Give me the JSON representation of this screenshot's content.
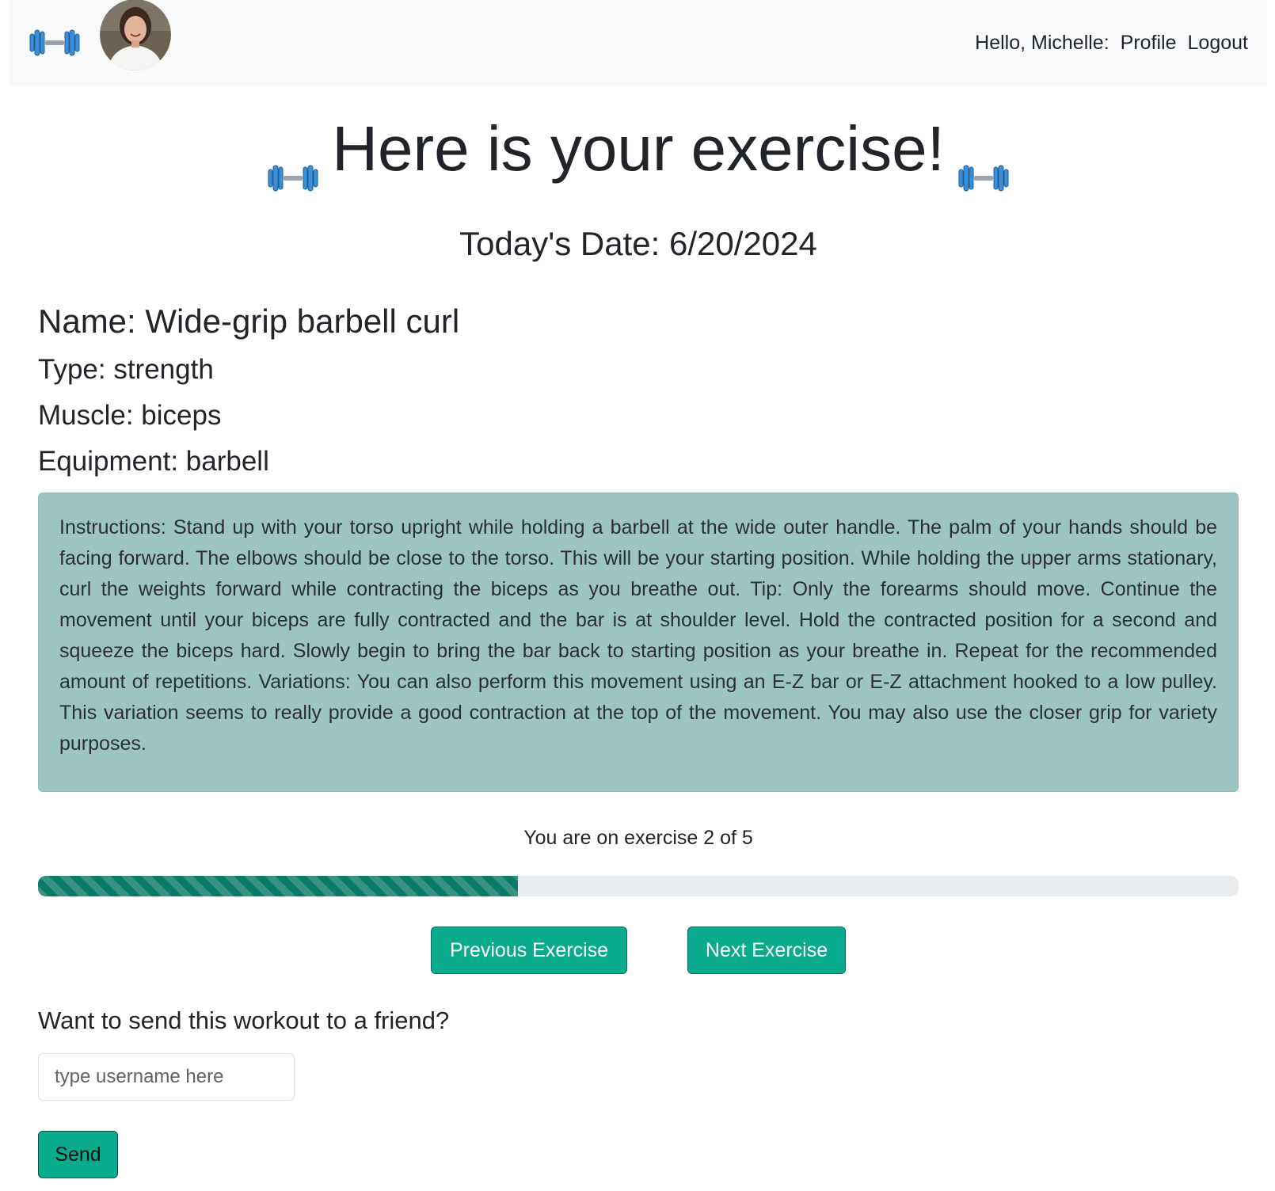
{
  "navbar": {
    "brand_icon": "dumbbell-icon",
    "avatar_alt": "user-avatar",
    "greeting": "Hello, Michelle:",
    "profile_link": "Profile",
    "logout_link": "Logout"
  },
  "hero": {
    "title": "Here is your exercise!",
    "left_icon": "dumbbell-icon",
    "right_icon": "dumbbell-icon"
  },
  "date_line": "Today's Date: 6/20/2024",
  "exercise": {
    "name": "Name: Wide-grip barbell curl",
    "type": "Type: strength",
    "muscle": "Muscle: biceps",
    "equipment": "Equipment: barbell",
    "instructions": "Instructions: Stand up with your torso upright while holding a barbell at the wide outer handle. The palm of your hands should be facing forward. The elbows should be close to the torso. This will be your starting position. While holding the upper arms stationary, curl the weights forward while contracting the biceps as you breathe out. Tip: Only the forearms should move. Continue the movement until your biceps are fully contracted and the bar is at shoulder level. Hold the contracted position for a second and squeeze the biceps hard. Slowly begin to bring the bar back to starting position as your breathe in. Repeat for the recommended amount of repetitions. Variations: You can also perform this movement using an E-Z bar or E-Z attachment hooked to a low pulley. This variation seems to really provide a good contraction at the top of the movement. You may also use the closer grip for variety purposes."
  },
  "progress": {
    "label": "You are on exercise 2 of 5",
    "current": 2,
    "total": 5,
    "fill_fraction": 0.4
  },
  "buttons": {
    "previous": "Previous Exercise",
    "next": "Next Exercise"
  },
  "share": {
    "title": "Want to send this workout to a friend?",
    "input_placeholder": "type username here",
    "input_value": "",
    "send_label": "Send"
  },
  "colors": {
    "navbar_bg": "#f8f9fa",
    "instructions_bg": "#9cc5c1",
    "accent": "#0aaa8c",
    "progress_fill": "#0b7a66",
    "progress_track": "#e9ecef",
    "dumbbell_blue": "#3b8fd6"
  }
}
